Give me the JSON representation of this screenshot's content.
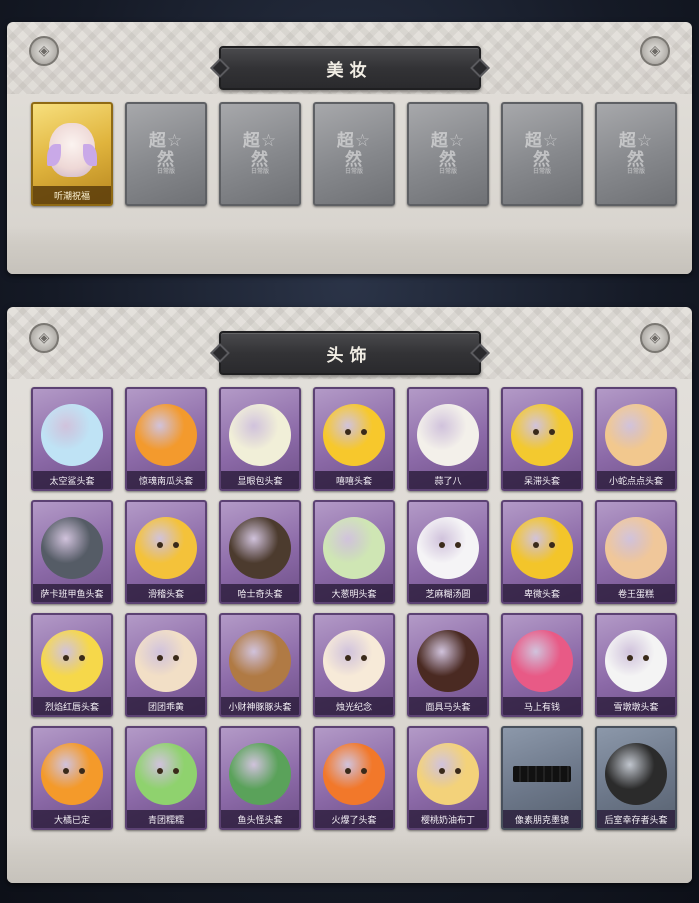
{
  "makeup": {
    "title": "美妆",
    "items": [
      {
        "label": "听潮祝福",
        "state": "owned",
        "icon": "angel-wings-face-icon"
      },
      {
        "label": "",
        "state": "locked",
        "mark": "超☆然",
        "sub": "日常版"
      },
      {
        "label": "",
        "state": "locked",
        "mark": "超☆然",
        "sub": "日常版"
      },
      {
        "label": "",
        "state": "locked",
        "mark": "超☆然",
        "sub": "日常版"
      },
      {
        "label": "",
        "state": "locked",
        "mark": "超☆然",
        "sub": "日常版"
      },
      {
        "label": "",
        "state": "locked",
        "mark": "超☆然",
        "sub": "日常版"
      },
      {
        "label": "",
        "state": "locked",
        "mark": "超☆然",
        "sub": "日常版"
      }
    ]
  },
  "headwear": {
    "title": "头饰",
    "items": [
      {
        "label": "太空鲨头套",
        "icon": "shark-head-icon",
        "color": "#bfe3f5"
      },
      {
        "label": "惊魂南瓜头套",
        "icon": "pumpkin-head-icon",
        "color": "#f39a2d"
      },
      {
        "label": "显眼包头套",
        "icon": "lightbulb-head-icon",
        "color": "#f1efd8"
      },
      {
        "label": "嘻嘻头套",
        "icon": "grin-emoji-icon",
        "color": "#f7c82c"
      },
      {
        "label": "蒜了八",
        "icon": "garlic-head-icon",
        "color": "#f3f0ea"
      },
      {
        "label": "呆滞头套",
        "icon": "dazed-emoji-icon",
        "color": "#f3c92f"
      },
      {
        "label": "小蛇点点头套",
        "icon": "snake-head-icon",
        "color": "#f2c88e"
      },
      {
        "label": "萨卡班甲鱼头套",
        "icon": "fish-head-icon",
        "color": "#555c66"
      },
      {
        "label": "滑稽头套",
        "icon": "funny-emoji-icon",
        "color": "#f4c23a"
      },
      {
        "label": "哈士奇头套",
        "icon": "husky-head-icon",
        "color": "#4c3b2e"
      },
      {
        "label": "大葱明头套",
        "icon": "scallion-head-icon",
        "color": "#cfe6b4"
      },
      {
        "label": "芝麻糊汤圆",
        "icon": "dumpling-head-icon",
        "color": "#f5f4f6"
      },
      {
        "label": "卑微头套",
        "icon": "humble-emoji-icon",
        "color": "#f3c52a"
      },
      {
        "label": "卷王蛋糕",
        "icon": "roll-cake-head-icon",
        "color": "#f0c79a"
      },
      {
        "label": "烈焰红唇头套",
        "icon": "pikachu-head-icon",
        "color": "#f6d84a"
      },
      {
        "label": "团团乖黄",
        "icon": "hamster-head-icon",
        "color": "#f2dfc6"
      },
      {
        "label": "小财神豚豚头套",
        "icon": "capybara-head-icon",
        "color": "#b07a44"
      },
      {
        "label": "烛光纪念",
        "icon": "candle-head-icon",
        "color": "#f7ead8"
      },
      {
        "label": "面具马头套",
        "icon": "horse-head-icon",
        "color": "#4a2a22"
      },
      {
        "label": "马上有钱",
        "icon": "pink-horse-head-icon",
        "color": "#e85a86"
      },
      {
        "label": "雪墩墩头套",
        "icon": "snowman-head-icon",
        "color": "#f4f4f4"
      },
      {
        "label": "大橘已定",
        "icon": "orange-head-icon",
        "color": "#f49a2a"
      },
      {
        "label": "青团糯糯",
        "icon": "green-dumpling-head-icon",
        "color": "#8fd26e"
      },
      {
        "label": "鱼头怪头套",
        "icon": "fish-monster-head-icon",
        "color": "#5aa25a"
      },
      {
        "label": "火爆了头套",
        "icon": "fire-head-icon",
        "color": "#f2782a"
      },
      {
        "label": "樱桃奶油布丁",
        "icon": "pudding-head-icon",
        "color": "#f3d27a"
      },
      {
        "label": "像素朋克墨镜",
        "icon": "pixel-sunglasses-icon",
        "color": "#1b1b1b",
        "card": "blue-grey"
      },
      {
        "label": "后室幸存者头套",
        "icon": "gas-mask-head-icon",
        "color": "#2b2b2b",
        "card": "blue-grey"
      }
    ]
  }
}
